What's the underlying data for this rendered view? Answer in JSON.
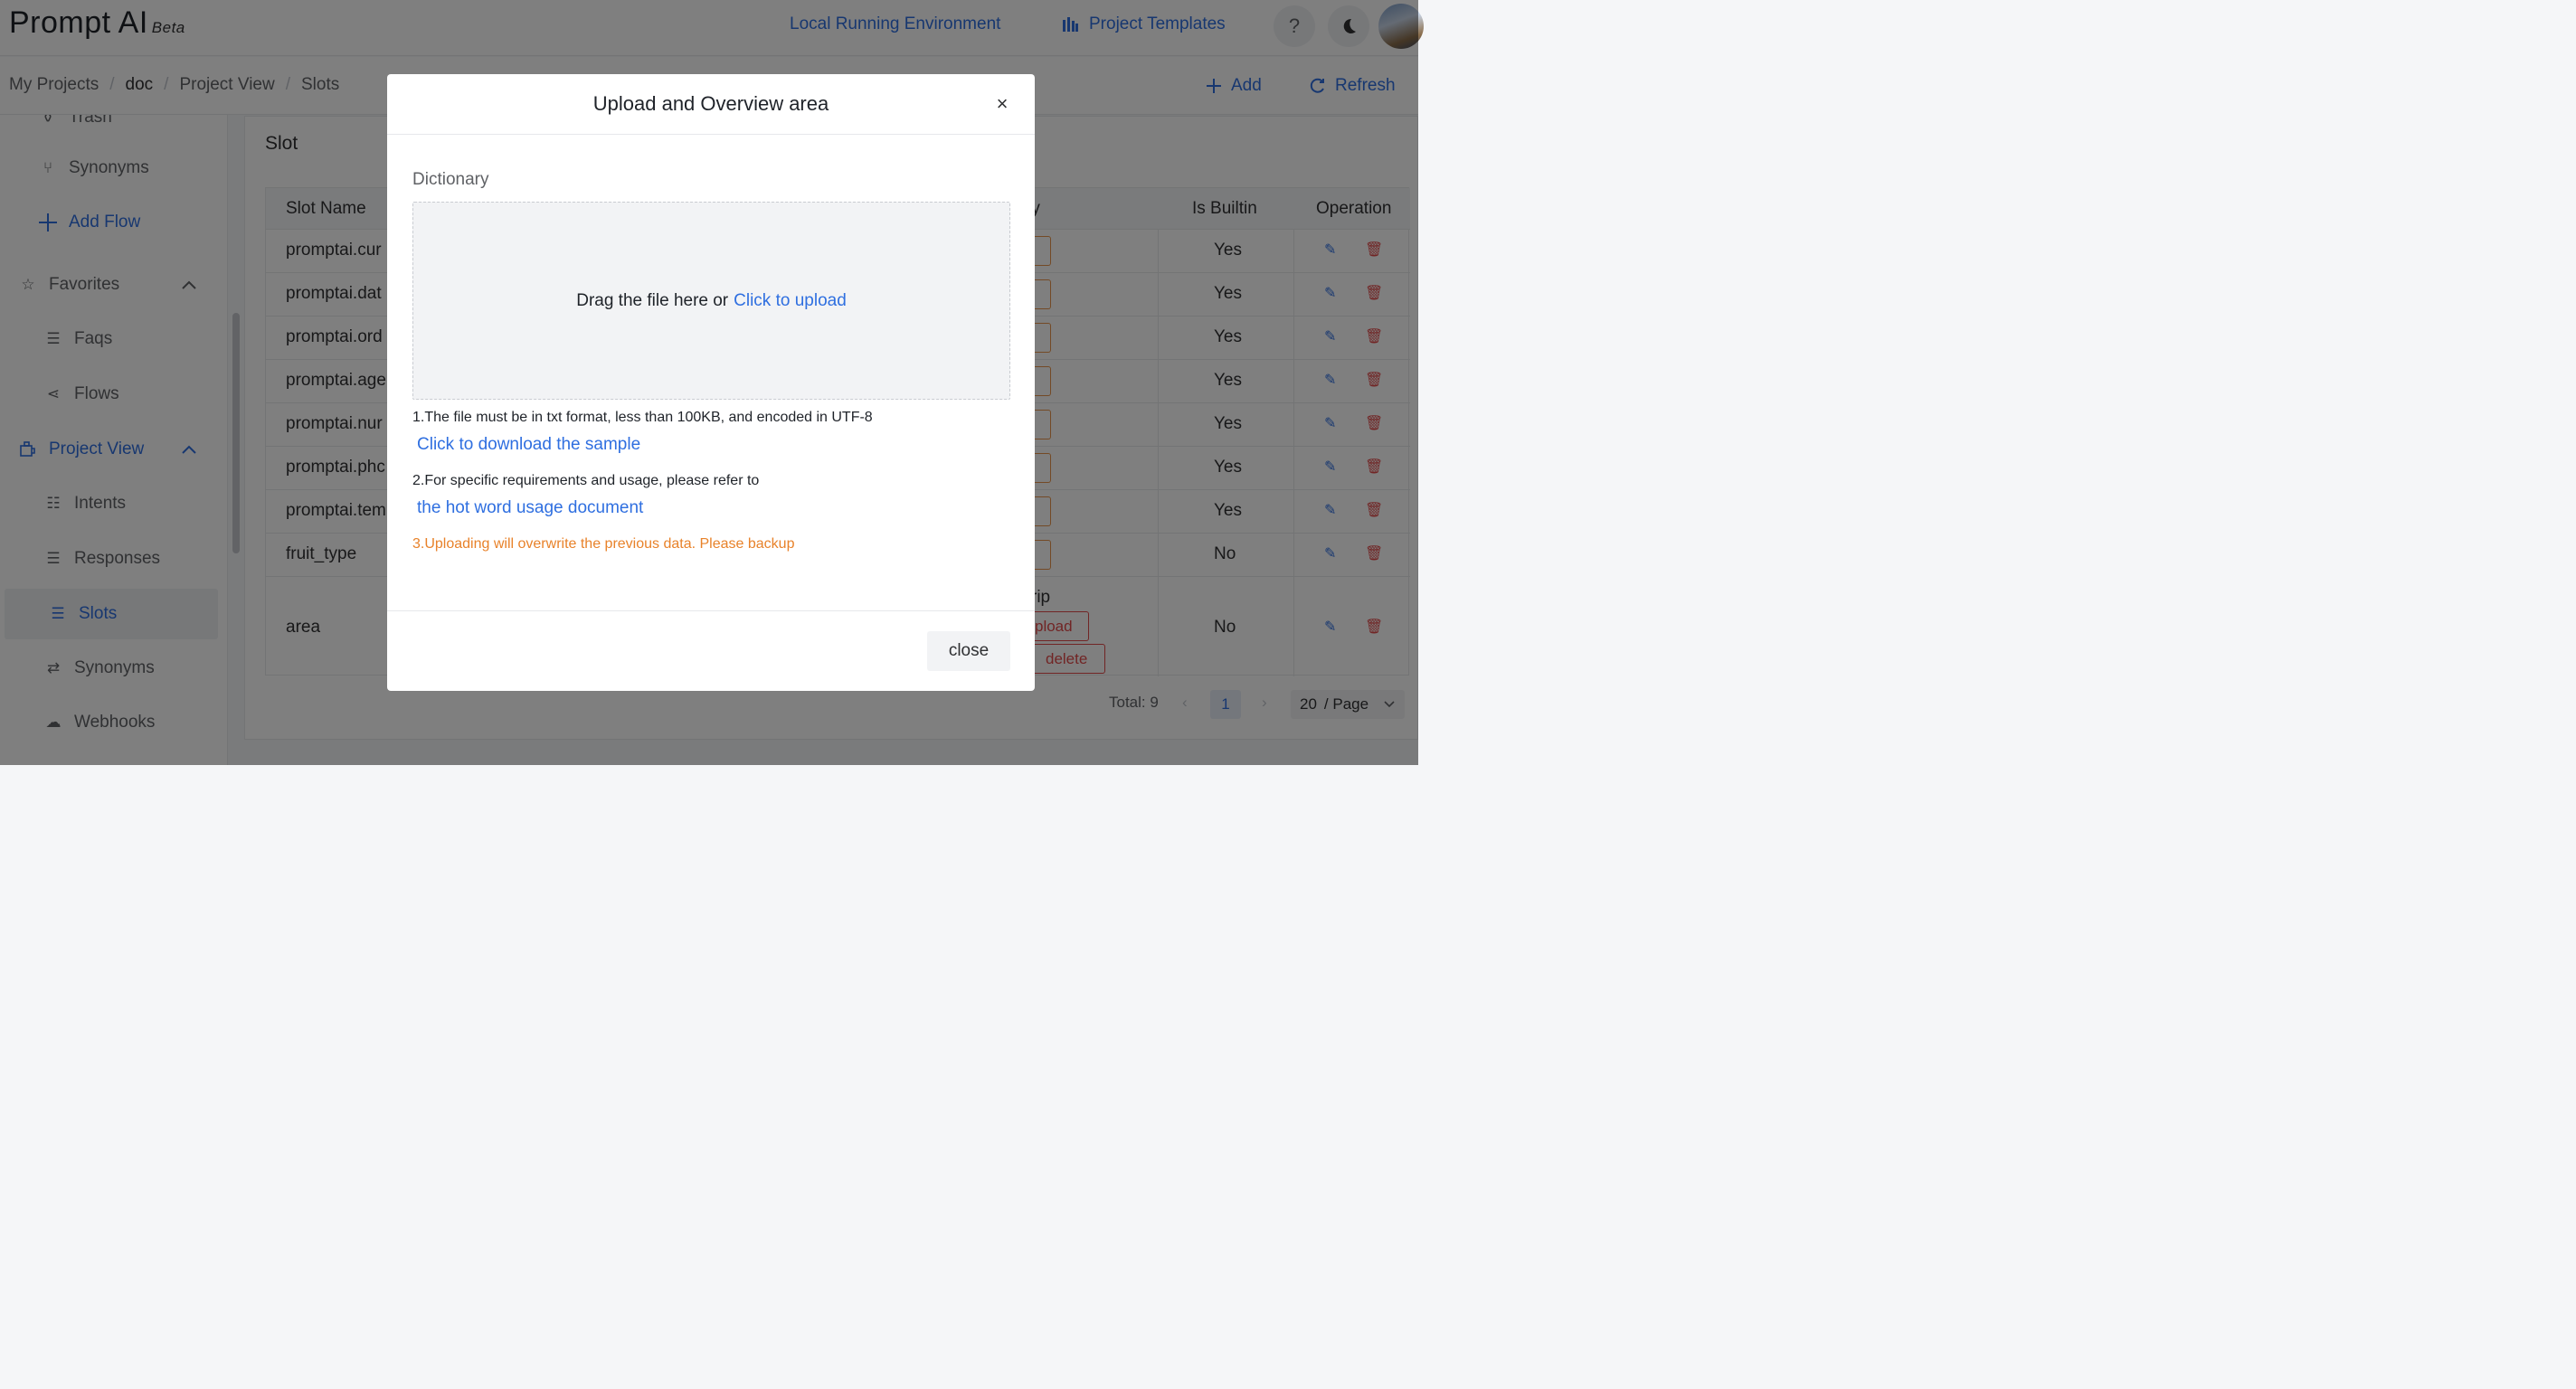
{
  "app": {
    "name": "Prompt AI",
    "badge": "Beta"
  },
  "header": {
    "env_link": "Local Running Environment",
    "templates_link": "Project Templates",
    "help_glyph": "?",
    "icons": [
      "templates-icon",
      "help-icon",
      "theme-toggle-icon",
      "avatar"
    ]
  },
  "breadcrumb": {
    "items": [
      "My Projects",
      "doc",
      "Project View",
      "Slots"
    ],
    "separator": "/",
    "add_label": "Add",
    "refresh_label": "Refresh"
  },
  "sidebar": {
    "items": [
      {
        "label": "Trash",
        "icon": "trash-icon"
      },
      {
        "label": "Synonyms",
        "icon": "branch-icon"
      },
      {
        "label": "Add Flow",
        "icon": "plus-icon"
      },
      {
        "label": "Favorites",
        "icon": "star-icon",
        "expanded": true
      },
      {
        "label": "Faqs",
        "icon": "list-icon"
      },
      {
        "label": "Flows",
        "icon": "flow-icon"
      },
      {
        "label": "Project View",
        "icon": "project-icon",
        "expanded": true
      },
      {
        "label": "Intents",
        "icon": "intents-icon"
      },
      {
        "label": "Responses",
        "icon": "responses-icon"
      },
      {
        "label": "Slots",
        "icon": "slots-icon",
        "active": true
      },
      {
        "label": "Synonyms",
        "icon": "swap-icon"
      },
      {
        "label": "Webhooks",
        "icon": "cloud-icon"
      }
    ]
  },
  "page": {
    "title": "Slot",
    "table": {
      "columns": [
        "Slot Name",
        "ry",
        "Is Builtin",
        "Operation"
      ],
      "rows": [
        {
          "name": "promptai.cur",
          "builtin": "Yes"
        },
        {
          "name": "promptai.dat",
          "builtin": "Yes"
        },
        {
          "name": "promptai.ord",
          "builtin": "Yes"
        },
        {
          "name": "promptai.age",
          "builtin": "Yes"
        },
        {
          "name": "promptai.nur",
          "builtin": "Yes"
        },
        {
          "name": "promptai.phc",
          "builtin": "Yes"
        },
        {
          "name": "promptai.tem",
          "builtin": "Yes"
        },
        {
          "name": "fruit_type",
          "builtin": "No"
        },
        {
          "name": "area",
          "builtin": "No",
          "dictionary_text": "rip",
          "upload_label": "pload",
          "delete_label": "delete"
        }
      ]
    },
    "pagination": {
      "total_label": "Total: 9",
      "current_page": "1",
      "page_size": "20",
      "page_size_suffix": "/ Page"
    }
  },
  "modal": {
    "title": "Upload and Overview area",
    "close_glyph": "×",
    "field_label": "Dictionary",
    "dropzone_text": "Drag the file here or",
    "dropzone_link": "Click to upload",
    "note1": "1.The file must be in txt format, less than 100KB, and encoded in UTF-8",
    "note1_link": "Click to download the sample",
    "note2": "2.For specific requirements and usage, please refer to",
    "note2_link": "the hot word usage document",
    "note3": "3.Uploading will overwrite the previous data. Please backup",
    "close_button": "close",
    "colors": {
      "link": "#2f6fe0",
      "warning": "#e8822a",
      "danger": "#e24a4a"
    }
  }
}
